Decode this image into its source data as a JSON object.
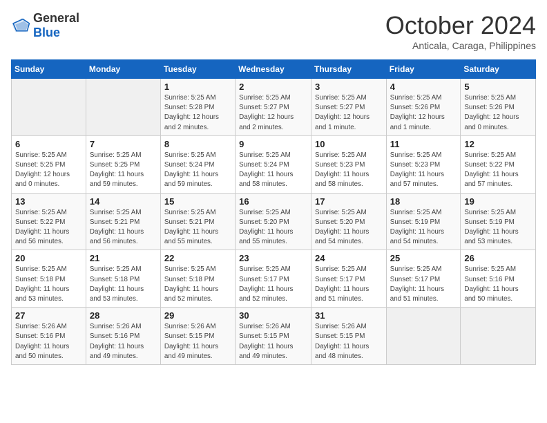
{
  "header": {
    "logo_general": "General",
    "logo_blue": "Blue",
    "title": "October 2024",
    "subtitle": "Anticala, Caraga, Philippines"
  },
  "days_of_week": [
    "Sunday",
    "Monday",
    "Tuesday",
    "Wednesday",
    "Thursday",
    "Friday",
    "Saturday"
  ],
  "weeks": [
    [
      {
        "day": "",
        "info": ""
      },
      {
        "day": "",
        "info": ""
      },
      {
        "day": "1",
        "info": "Sunrise: 5:25 AM\nSunset: 5:28 PM\nDaylight: 12 hours\nand 2 minutes."
      },
      {
        "day": "2",
        "info": "Sunrise: 5:25 AM\nSunset: 5:27 PM\nDaylight: 12 hours\nand 2 minutes."
      },
      {
        "day": "3",
        "info": "Sunrise: 5:25 AM\nSunset: 5:27 PM\nDaylight: 12 hours\nand 1 minute."
      },
      {
        "day": "4",
        "info": "Sunrise: 5:25 AM\nSunset: 5:26 PM\nDaylight: 12 hours\nand 1 minute."
      },
      {
        "day": "5",
        "info": "Sunrise: 5:25 AM\nSunset: 5:26 PM\nDaylight: 12 hours\nand 0 minutes."
      }
    ],
    [
      {
        "day": "6",
        "info": "Sunrise: 5:25 AM\nSunset: 5:25 PM\nDaylight: 12 hours\nand 0 minutes."
      },
      {
        "day": "7",
        "info": "Sunrise: 5:25 AM\nSunset: 5:25 PM\nDaylight: 11 hours\nand 59 minutes."
      },
      {
        "day": "8",
        "info": "Sunrise: 5:25 AM\nSunset: 5:24 PM\nDaylight: 11 hours\nand 59 minutes."
      },
      {
        "day": "9",
        "info": "Sunrise: 5:25 AM\nSunset: 5:24 PM\nDaylight: 11 hours\nand 58 minutes."
      },
      {
        "day": "10",
        "info": "Sunrise: 5:25 AM\nSunset: 5:23 PM\nDaylight: 11 hours\nand 58 minutes."
      },
      {
        "day": "11",
        "info": "Sunrise: 5:25 AM\nSunset: 5:23 PM\nDaylight: 11 hours\nand 57 minutes."
      },
      {
        "day": "12",
        "info": "Sunrise: 5:25 AM\nSunset: 5:22 PM\nDaylight: 11 hours\nand 57 minutes."
      }
    ],
    [
      {
        "day": "13",
        "info": "Sunrise: 5:25 AM\nSunset: 5:22 PM\nDaylight: 11 hours\nand 56 minutes."
      },
      {
        "day": "14",
        "info": "Sunrise: 5:25 AM\nSunset: 5:21 PM\nDaylight: 11 hours\nand 56 minutes."
      },
      {
        "day": "15",
        "info": "Sunrise: 5:25 AM\nSunset: 5:21 PM\nDaylight: 11 hours\nand 55 minutes."
      },
      {
        "day": "16",
        "info": "Sunrise: 5:25 AM\nSunset: 5:20 PM\nDaylight: 11 hours\nand 55 minutes."
      },
      {
        "day": "17",
        "info": "Sunrise: 5:25 AM\nSunset: 5:20 PM\nDaylight: 11 hours\nand 54 minutes."
      },
      {
        "day": "18",
        "info": "Sunrise: 5:25 AM\nSunset: 5:19 PM\nDaylight: 11 hours\nand 54 minutes."
      },
      {
        "day": "19",
        "info": "Sunrise: 5:25 AM\nSunset: 5:19 PM\nDaylight: 11 hours\nand 53 minutes."
      }
    ],
    [
      {
        "day": "20",
        "info": "Sunrise: 5:25 AM\nSunset: 5:18 PM\nDaylight: 11 hours\nand 53 minutes."
      },
      {
        "day": "21",
        "info": "Sunrise: 5:25 AM\nSunset: 5:18 PM\nDaylight: 11 hours\nand 53 minutes."
      },
      {
        "day": "22",
        "info": "Sunrise: 5:25 AM\nSunset: 5:18 PM\nDaylight: 11 hours\nand 52 minutes."
      },
      {
        "day": "23",
        "info": "Sunrise: 5:25 AM\nSunset: 5:17 PM\nDaylight: 11 hours\nand 52 minutes."
      },
      {
        "day": "24",
        "info": "Sunrise: 5:25 AM\nSunset: 5:17 PM\nDaylight: 11 hours\nand 51 minutes."
      },
      {
        "day": "25",
        "info": "Sunrise: 5:25 AM\nSunset: 5:17 PM\nDaylight: 11 hours\nand 51 minutes."
      },
      {
        "day": "26",
        "info": "Sunrise: 5:25 AM\nSunset: 5:16 PM\nDaylight: 11 hours\nand 50 minutes."
      }
    ],
    [
      {
        "day": "27",
        "info": "Sunrise: 5:26 AM\nSunset: 5:16 PM\nDaylight: 11 hours\nand 50 minutes."
      },
      {
        "day": "28",
        "info": "Sunrise: 5:26 AM\nSunset: 5:16 PM\nDaylight: 11 hours\nand 49 minutes."
      },
      {
        "day": "29",
        "info": "Sunrise: 5:26 AM\nSunset: 5:15 PM\nDaylight: 11 hours\nand 49 minutes."
      },
      {
        "day": "30",
        "info": "Sunrise: 5:26 AM\nSunset: 5:15 PM\nDaylight: 11 hours\nand 49 minutes."
      },
      {
        "day": "31",
        "info": "Sunrise: 5:26 AM\nSunset: 5:15 PM\nDaylight: 11 hours\nand 48 minutes."
      },
      {
        "day": "",
        "info": ""
      },
      {
        "day": "",
        "info": ""
      }
    ]
  ]
}
